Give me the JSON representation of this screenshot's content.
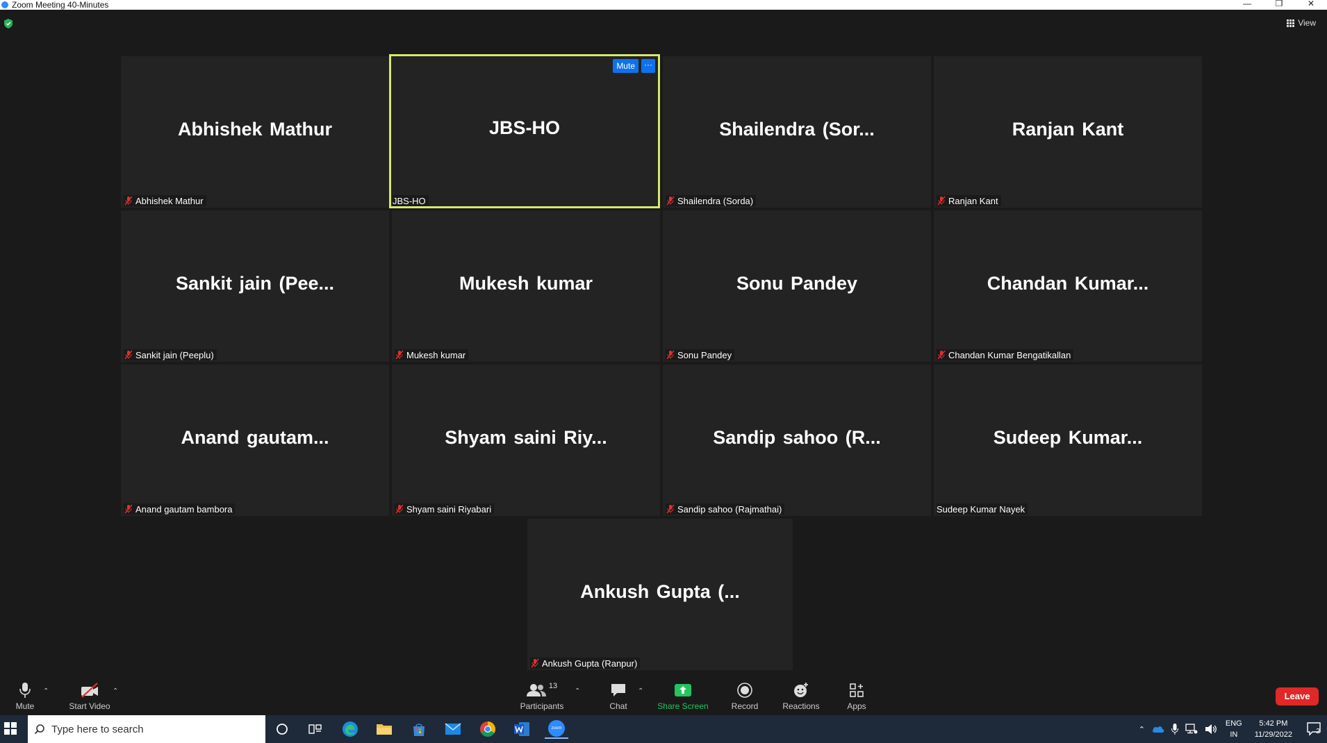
{
  "window": {
    "title": "Zoom Meeting 40-Minutes",
    "controls": [
      "—",
      "❐",
      "✕"
    ]
  },
  "view_button": {
    "label": "View"
  },
  "tiles": [
    {
      "big": "Abhishek Mathur",
      "label": "Abhishek Mathur",
      "muted": true
    },
    {
      "big": "JBS-HO",
      "label": "JBS-HO",
      "muted": false,
      "active": true,
      "mute_label": "Mute",
      "more_label": "···"
    },
    {
      "big": "Shailendra  (Sor...",
      "label": "Shailendra (Sorda)",
      "muted": true
    },
    {
      "big": "Ranjan Kant",
      "label": "Ranjan Kant",
      "muted": true
    },
    {
      "big": "Sankit jain  (Pee...",
      "label": "Sankit jain (Peeplu)",
      "muted": true
    },
    {
      "big": "Mukesh kumar",
      "label": "Mukesh kumar",
      "muted": true
    },
    {
      "big": "Sonu Pandey",
      "label": "Sonu Pandey",
      "muted": true
    },
    {
      "big": "Chandan  Kumar...",
      "label": "Chandan Kumar Bengatikallan",
      "muted": true
    },
    {
      "big": "Anand  gautam...",
      "label": "Anand gautam bambora",
      "muted": true
    },
    {
      "big": "Shyam saini Riy...",
      "label": "Shyam saini Riyabari",
      "muted": true
    },
    {
      "big": "Sandip sahoo  (R...",
      "label": "Sandip sahoo (Rajmathai)",
      "muted": true
    },
    {
      "big": "Sudeep  Kumar...",
      "label": "Sudeep Kumar Nayek",
      "muted": false
    },
    {
      "big": "Ankush Gupta  (...",
      "label": "Ankush Gupta (Ranpur)",
      "muted": true
    }
  ],
  "toolbar": {
    "mute": "Mute",
    "start_video": "Start Video",
    "participants": "Participants",
    "participants_count": "13",
    "chat": "Chat",
    "share_screen": "Share Screen",
    "record": "Record",
    "reactions": "Reactions",
    "apps": "Apps",
    "leave": "Leave"
  },
  "taskbar": {
    "search_placeholder": "Type here to search",
    "lang_top": "ENG",
    "lang_bottom": "IN",
    "time": "5:42 PM",
    "date": "11/29/2022",
    "notification_count": "2",
    "zoom_app_label": "zoom"
  },
  "colors": {
    "accent_blue": "#0e72ed",
    "active_border": "#d8e86a",
    "leave_red": "#e02828",
    "share_green": "#22c55e",
    "muted_red": "#e03030"
  }
}
